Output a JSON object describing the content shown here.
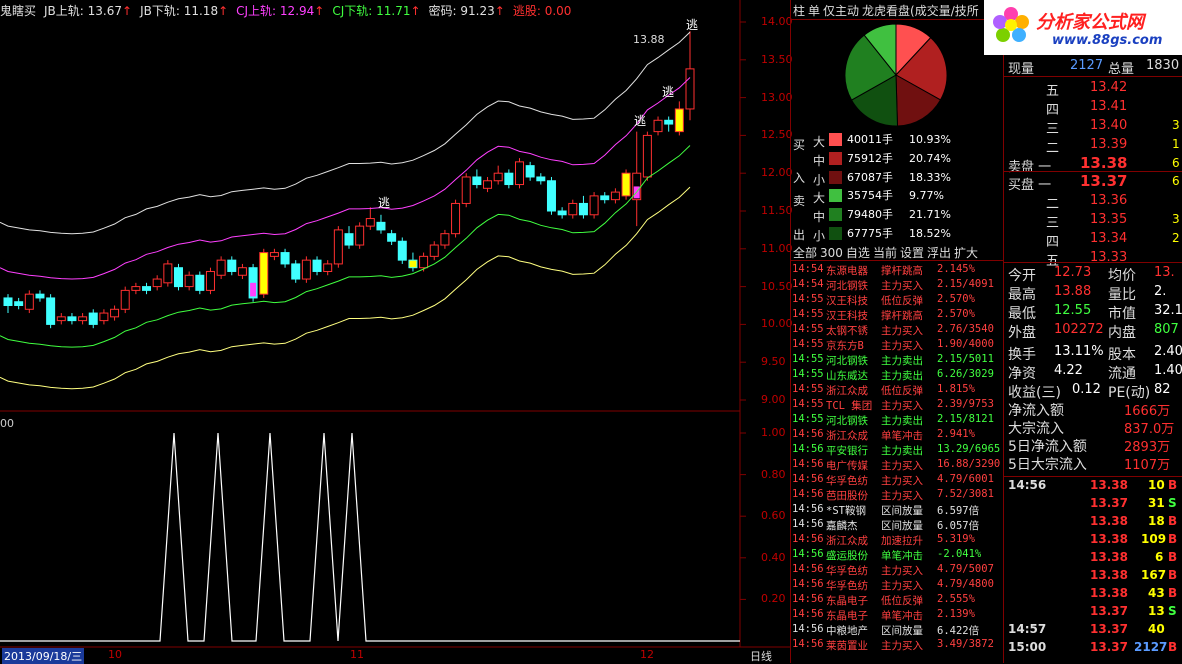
{
  "indicator_bar": {
    "items": [
      {
        "label": "鬼瞎买",
        "value": "",
        "color": "#e0e0e0"
      },
      {
        "label": "JB上轨:",
        "value": "13.67",
        "color": "#e0e0e0",
        "arrow": "↑"
      },
      {
        "label": "JB下轨:",
        "value": "11.18",
        "color": "#e0e0e0",
        "arrow": "↑"
      },
      {
        "label": "CJ上轨:",
        "value": "12.94",
        "color": "#ff40ff",
        "arrow": "↑"
      },
      {
        "label": "CJ下轨:",
        "value": "11.71",
        "color": "#40ff40",
        "arrow": "↑"
      },
      {
        "label": "密码:",
        "value": "91.23",
        "color": "#e0e0e0",
        "arrow": "↑"
      },
      {
        "label": "逃股:",
        "value": "0.00",
        "color": "#ff3030",
        "arrow": ""
      }
    ]
  },
  "price_axis": {
    "ticks": [
      "14.00",
      "13.50",
      "13.00",
      "12.50",
      "12.00",
      "11.50",
      "11.00",
      "10.50",
      "10.00",
      "9.50",
      "9.00"
    ]
  },
  "indicator_axis": {
    "ticks": [
      "1.00",
      "0.80",
      "0.60",
      "0.40",
      "0.20"
    ],
    "top_label": "00"
  },
  "annotations": {
    "high_label": "13.88",
    "escape_label": "逃"
  },
  "date_axis": {
    "current_date": "2013/09/18/三",
    "months": [
      "10",
      "11",
      "12"
    ],
    "period": "日线"
  },
  "chart_data": {
    "type": "candlestick",
    "ylim": [
      9.0,
      14.0
    ],
    "candles": [
      [
        10.35,
        10.25,
        10.4,
        10.15
      ],
      [
        10.3,
        10.25,
        10.35,
        10.2
      ],
      [
        10.2,
        10.4,
        10.45,
        10.15
      ],
      [
        10.4,
        10.35,
        10.45,
        10.3
      ],
      [
        10.35,
        10.0,
        10.4,
        9.95
      ],
      [
        10.05,
        10.1,
        10.15,
        10.0
      ],
      [
        10.1,
        10.05,
        10.15,
        10.0
      ],
      [
        10.05,
        10.1,
        10.15,
        10.0
      ],
      [
        10.15,
        10.0,
        10.2,
        9.95
      ],
      [
        10.05,
        10.15,
        10.2,
        10.0
      ],
      [
        10.1,
        10.2,
        10.25,
        10.05
      ],
      [
        10.2,
        10.45,
        10.5,
        10.15
      ],
      [
        10.45,
        10.5,
        10.55,
        10.4
      ],
      [
        10.5,
        10.45,
        10.55,
        10.4
      ],
      [
        10.5,
        10.6,
        10.65,
        10.45
      ],
      [
        10.55,
        10.8,
        10.85,
        10.5
      ],
      [
        10.75,
        10.5,
        10.8,
        10.45
      ],
      [
        10.5,
        10.65,
        10.7,
        10.45
      ],
      [
        10.65,
        10.45,
        10.7,
        10.4
      ],
      [
        10.45,
        10.7,
        10.75,
        10.4
      ],
      [
        10.65,
        10.85,
        10.9,
        10.6
      ],
      [
        10.85,
        10.7,
        10.9,
        10.65
      ],
      [
        10.65,
        10.75,
        10.8,
        10.6
      ],
      [
        10.75,
        10.35,
        10.8,
        10.3
      ],
      [
        10.4,
        10.95,
        11.0,
        10.35
      ],
      [
        10.9,
        10.95,
        11.0,
        10.85
      ],
      [
        10.95,
        10.8,
        11.0,
        10.75
      ],
      [
        10.8,
        10.6,
        10.85,
        10.55
      ],
      [
        10.6,
        10.85,
        10.9,
        10.55
      ],
      [
        10.85,
        10.7,
        10.9,
        10.65
      ],
      [
        10.7,
        10.8,
        10.85,
        10.65
      ],
      [
        10.8,
        11.25,
        11.3,
        10.75
      ],
      [
        11.2,
        11.05,
        11.3,
        11.0
      ],
      [
        11.05,
        11.3,
        11.35,
        11.0
      ],
      [
        11.3,
        11.4,
        11.55,
        11.25
      ],
      [
        11.35,
        11.25,
        11.45,
        11.2
      ],
      [
        11.2,
        11.1,
        11.25,
        11.05
      ],
      [
        11.1,
        10.85,
        11.15,
        10.8
      ],
      [
        10.85,
        10.75,
        10.95,
        10.7
      ],
      [
        10.75,
        10.9,
        10.95,
        10.7
      ],
      [
        10.9,
        11.05,
        11.1,
        10.85
      ],
      [
        11.05,
        11.2,
        11.25,
        11.0
      ],
      [
        11.2,
        11.6,
        11.65,
        11.15
      ],
      [
        11.6,
        11.95,
        12.0,
        11.55
      ],
      [
        11.95,
        11.85,
        12.05,
        11.8
      ],
      [
        11.8,
        11.9,
        11.95,
        11.75
      ],
      [
        11.9,
        12.0,
        12.1,
        11.85
      ],
      [
        12.0,
        11.85,
        12.05,
        11.8
      ],
      [
        11.85,
        12.15,
        12.2,
        11.8
      ],
      [
        12.1,
        11.95,
        12.15,
        11.9
      ],
      [
        11.95,
        11.9,
        12.0,
        11.85
      ],
      [
        11.9,
        11.5,
        11.95,
        11.45
      ],
      [
        11.5,
        11.45,
        11.55,
        11.4
      ],
      [
        11.45,
        11.6,
        11.65,
        11.4
      ],
      [
        11.6,
        11.45,
        11.7,
        11.4
      ],
      [
        11.45,
        11.7,
        11.75,
        11.4
      ],
      [
        11.7,
        11.65,
        11.75,
        11.6
      ],
      [
        11.65,
        11.75,
        11.8,
        11.6
      ],
      [
        11.7,
        12.0,
        12.05,
        11.65
      ],
      [
        11.65,
        12.0,
        12.55,
        11.3
      ],
      [
        11.95,
        12.5,
        12.55,
        11.9
      ],
      [
        12.55,
        12.7,
        12.75,
        12.5
      ],
      [
        12.7,
        12.65,
        12.75,
        12.55
      ],
      [
        12.55,
        12.85,
        12.95,
        12.5
      ],
      [
        12.85,
        13.38,
        13.88,
        12.7
      ]
    ]
  },
  "mid_panel": {
    "tabs": [
      "柱",
      "单",
      "仅主动",
      "龙虎看盘(成交量/技所"
    ],
    "buy_label_top": "买",
    "buy_label_bottom": "入",
    "sell_label_top": "卖",
    "sell_label_bottom": "出",
    "buy_rows": [
      {
        "level": "大",
        "vol": "40011手",
        "pct": "10.93%",
        "color": "#ff5050"
      },
      {
        "level": "中",
        "vol": "75912手",
        "pct": "20.74%",
        "color": "#b02020"
      },
      {
        "level": "小",
        "vol": "67087手",
        "pct": "18.33%",
        "color": "#701010"
      }
    ],
    "sell_rows": [
      {
        "level": "大",
        "vol": "35754手",
        "pct": "9.77%",
        "color": "#40c040"
      },
      {
        "level": "中",
        "vol": "79480手",
        "pct": "21.71%",
        "color": "#208020"
      },
      {
        "level": "小",
        "vol": "67775手",
        "pct": "18.52%",
        "color": "#105010"
      }
    ],
    "controls": [
      "全部",
      "300",
      "自选",
      "当前",
      "设置",
      "浮出",
      "扩大"
    ],
    "trades": [
      {
        "time": "14:54",
        "name": "东源电器",
        "type": "撑杆跳高",
        "val": "2.145%",
        "c": "r"
      },
      {
        "time": "14:54",
        "name": "河北钢铁",
        "type": "主力买入",
        "val": "2.15/4091",
        "c": "r"
      },
      {
        "time": "14:55",
        "name": "汉王科技",
        "type": "低位反弹",
        "val": "2.570%",
        "c": "r"
      },
      {
        "time": "14:55",
        "name": "汉王科技",
        "type": "撑杆跳高",
        "val": "2.570%",
        "c": "r"
      },
      {
        "time": "14:55",
        "name": "太钢不锈",
        "type": "主力买入",
        "val": "2.76/3540",
        "c": "r"
      },
      {
        "time": "14:55",
        "name": "京东方B",
        "type": "主力买入",
        "val": "1.90/4000",
        "c": "r"
      },
      {
        "time": "14:55",
        "name": "河北钢铁",
        "type": "主力卖出",
        "val": "2.15/5011",
        "c": "g"
      },
      {
        "time": "14:55",
        "name": "山东威达",
        "type": "主力卖出",
        "val": "6.26/3029",
        "c": "g"
      },
      {
        "time": "14:55",
        "name": "浙江众成",
        "type": "低位反弹",
        "val": "1.815%",
        "c": "r"
      },
      {
        "time": "14:55",
        "name": "TCL 集团",
        "type": "主力买入",
        "val": "2.39/9753",
        "c": "r"
      },
      {
        "time": "14:55",
        "name": "河北钢铁",
        "type": "主力卖出",
        "val": "2.15/8121",
        "c": "g"
      },
      {
        "time": "14:56",
        "name": "浙江众成",
        "type": "单笔冲击",
        "val": "2.941%",
        "c": "r"
      },
      {
        "time": "14:56",
        "name": "平安银行",
        "type": "主力卖出",
        "val": "13.29/6965",
        "c": "g"
      },
      {
        "time": "14:56",
        "name": "电广传媒",
        "type": "主力买入",
        "val": "16.88/3290",
        "c": "r"
      },
      {
        "time": "14:56",
        "name": "华孚色纺",
        "type": "主力买入",
        "val": "4.79/6001",
        "c": "r"
      },
      {
        "time": "14:56",
        "name": "芭田股份",
        "type": "主力买入",
        "val": "7.52/3081",
        "c": "r"
      },
      {
        "time": "14:56",
        "name": "*ST鞍钢",
        "type": "区间放量",
        "val": "6.597倍",
        "c": "w"
      },
      {
        "time": "14:56",
        "name": "嘉麟杰",
        "type": "区间放量",
        "val": "6.057倍",
        "c": "w"
      },
      {
        "time": "14:56",
        "name": "浙江众成",
        "type": "加速拉升",
        "val": "5.319%",
        "c": "r"
      },
      {
        "time": "14:56",
        "name": "盛运股份",
        "type": "单笔冲击",
        "val": "-2.041%",
        "c": "g"
      },
      {
        "time": "14:56",
        "name": "华孚色纺",
        "type": "主力买入",
        "val": "4.79/5007",
        "c": "r"
      },
      {
        "time": "14:56",
        "name": "华孚色纺",
        "type": "主力买入",
        "val": "4.79/4800",
        "c": "r"
      },
      {
        "time": "14:56",
        "name": "东晶电子",
        "type": "低位反弹",
        "val": "2.555%",
        "c": "r"
      },
      {
        "time": "14:56",
        "name": "东晶电子",
        "type": "单笔冲击",
        "val": "2.139%",
        "c": "r"
      },
      {
        "time": "14:56",
        "name": "中粮地产",
        "type": "区间放量",
        "val": "6.422倍",
        "c": "w"
      },
      {
        "time": "14:56",
        "name": "莱茵置业",
        "type": "主力买入",
        "val": "3.49/3872",
        "c": "r"
      }
    ]
  },
  "right_panel": {
    "logo_text": "分析家公式网",
    "logo_url": "www.88gs.com",
    "now_vol_label": "现量",
    "now_vol": "2127",
    "total_vol_label": "总量",
    "total_vol": "1830",
    "sell_levels": [
      {
        "label": "五",
        "price": "13.42",
        "vol": ""
      },
      {
        "label": "四",
        "price": "13.41",
        "vol": ""
      },
      {
        "label": "三",
        "price": "13.40",
        "vol": "3"
      },
      {
        "label": "二",
        "price": "13.39",
        "vol": "1"
      },
      {
        "label": "卖盘 一",
        "price": "13.38",
        "vol": "6"
      }
    ],
    "buy_levels": [
      {
        "label": "买盘 一",
        "price": "13.37",
        "vol": "6"
      },
      {
        "label": "二",
        "price": "13.36",
        "vol": ""
      },
      {
        "label": "三",
        "price": "13.35",
        "vol": "3"
      },
      {
        "label": "四",
        "price": "13.34",
        "vol": "2"
      },
      {
        "label": "五",
        "price": "13.33",
        "vol": ""
      }
    ],
    "stats": [
      {
        "l1": "今开",
        "v1": "12.73",
        "c1": "#ff3030",
        "l2": "均价",
        "v2": "13.",
        "c2": "#ff3030"
      },
      {
        "l1": "最高",
        "v1": "13.88",
        "c1": "#ff3030",
        "l2": "量比",
        "v2": "2.",
        "c2": "#ffffff"
      },
      {
        "l1": "最低",
        "v1": "12.55",
        "c1": "#40ff40",
        "l2": "市值",
        "v2": "32.1",
        "c2": "#ffffff"
      },
      {
        "l1": "外盘",
        "v1": "102272",
        "c1": "#ff3030",
        "l2": "内盘",
        "v2": "807",
        "c2": "#40ff40"
      },
      {
        "l1": "换手",
        "v1": "13.11%",
        "c1": "#ffffff",
        "l2": "股本",
        "v2": "2.40",
        "c2": "#ffffff"
      },
      {
        "l1": "净资",
        "v1": "4.22",
        "c1": "#ffffff",
        "l2": "流通",
        "v2": "1.40",
        "c2": "#ffffff"
      },
      {
        "l1": "收益(三)",
        "v1": "0.12",
        "c1": "#ffffff",
        "l2": "PE(动)",
        "v2": "82",
        "c2": "#ffffff"
      }
    ],
    "flows": [
      {
        "label": "净流入额",
        "value": "1666万"
      },
      {
        "label": "大宗流入",
        "value": "837.0万"
      },
      {
        "label": "5日净流入额",
        "value": "2893万"
      },
      {
        "label": "5日大宗流入",
        "value": "1107万"
      }
    ],
    "ticks_time": "14:56",
    "ticks": [
      {
        "price": "13.38",
        "vol": "10",
        "side": "B"
      },
      {
        "price": "13.37",
        "vol": "31",
        "side": "S"
      },
      {
        "price": "13.38",
        "vol": "18",
        "side": "B"
      },
      {
        "price": "13.38",
        "vol": "109",
        "side": "B"
      },
      {
        "price": "13.38",
        "vol": "6",
        "side": "B"
      },
      {
        "price": "13.38",
        "vol": "167",
        "side": "B"
      },
      {
        "price": "13.38",
        "vol": "43",
        "side": "B"
      },
      {
        "price": "13.37",
        "vol": "13",
        "side": "S"
      }
    ],
    "tail_ticks": [
      {
        "time": "14:57",
        "price": "13.37",
        "vol": "40",
        "side": ""
      },
      {
        "time": "15:00",
        "price": "13.37",
        "vol": "2127",
        "side": "B"
      }
    ]
  }
}
